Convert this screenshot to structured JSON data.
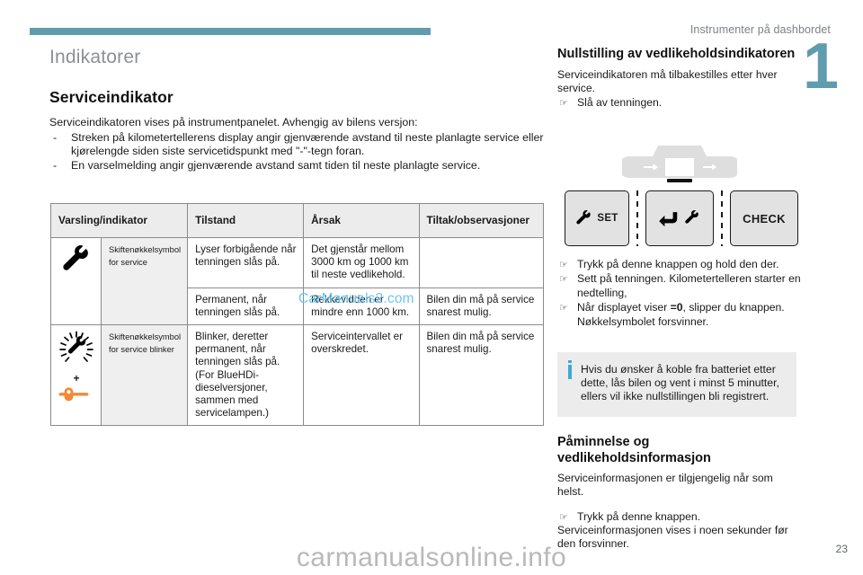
{
  "header": {
    "running_title": "Instrumenter på dashbordet",
    "chapter_number": "1",
    "rule_color": "#5f9cae"
  },
  "left": {
    "section_gray": "Indikatorer",
    "section_black": "Serviceindikator",
    "intro": "Serviceindikatoren vises på instrumentpanelet. Avhengig av bilens versjon:",
    "bullets": [
      {
        "marker": "-",
        "text": "Streken på kilometertellerens display angir gjenværende avstand til neste planlagte service eller kjørelengde siden siste servicetidspunkt med \"-\"-tegn foran."
      },
      {
        "marker": "-",
        "text": "En varselmelding angir gjenværende avstand samt tiden til neste planlagte service."
      }
    ]
  },
  "table": {
    "headers": [
      "Varsling/indikator",
      "Tilstand",
      "Årsak",
      "Tiltak/observasjoner"
    ],
    "rows": [
      {
        "icon": "wrench-icon",
        "icon_name": "Skiftenøkkelsymbol for service",
        "state": "Lyser forbigående når tenningen slås på.",
        "cause": "Det gjenstår mellom 3000 km og 1000 km til neste vedlikehold.",
        "action": ""
      },
      {
        "icon": "",
        "icon_name": "",
        "state": "Permanent, når tenningen slås på.",
        "cause": "Rekkevidden er mindre enn 1000 km.",
        "action": "Bilen din må på service snarest mulig."
      },
      {
        "icon": "wrench-blinking-icon",
        "icon_name": "Skiftenøkkelsymbol for service blinker",
        "state": "Blinker, deretter permanent, når tenningen slås på. (For BlueHDi-dieselversjoner, sammen med servicelampen.)",
        "cause": "Serviceintervallet er overskredet.",
        "action": "Bilen din må på service snarest mulig."
      }
    ],
    "plus_sign": "+",
    "watermark": "CarManuals2.com",
    "watermark_color": "#69c7ef"
  },
  "right": {
    "heading_1": "Nullstilling av vedlikeholdsindikatoren",
    "para_1": "Serviceindikatoren må tilbakestilles etter hver service.",
    "steps_1": [
      {
        "marker": "☞",
        "text": "Slå av tenningen."
      }
    ],
    "illustration": {
      "cluster_label": "instrument-cluster",
      "buttons": [
        {
          "name": "set-button",
          "icon": "wrench-icon",
          "label": "SET"
        },
        {
          "name": "back-button",
          "icon": "back-arrow-wrench-icon",
          "label": ""
        },
        {
          "name": "check-button",
          "icon": "",
          "label": "CHECK"
        }
      ]
    },
    "steps_2": [
      {
        "marker": "☞",
        "text": "Trykk på denne knappen og hold den der."
      },
      {
        "marker": "☞",
        "text": "Sett på tenningen. Kilometertelleren starter en nedtelling,"
      },
      {
        "marker": "☞",
        "text_before": "Når displayet viser ",
        "bold": "=0",
        "text_after": ", slipper du knappen. Nøkkelsymbolet forsvinner."
      }
    ],
    "note": {
      "icon": "info-icon",
      "text": "Hvis du ønsker å koble fra batteriet etter dette, lås bilen og vent i minst 5 minutter, ellers vil ikke nullstillingen bli registrert.",
      "accent_color": "#3fa9d4",
      "background": "#ececec"
    },
    "heading_2": "Påminnelse og vedlikeholdsinformasjon",
    "para_2": "Serviceinformasjonen er tilgjengelig når som helst.",
    "steps_3": [
      {
        "marker": "☞",
        "text": "Trykk på denne knappen."
      }
    ],
    "para_3": "Serviceinformasjonen vises i noen sekunder før den forsvinner."
  },
  "footer": {
    "watermark": "carmanualsonline.info",
    "page_number": "23"
  }
}
